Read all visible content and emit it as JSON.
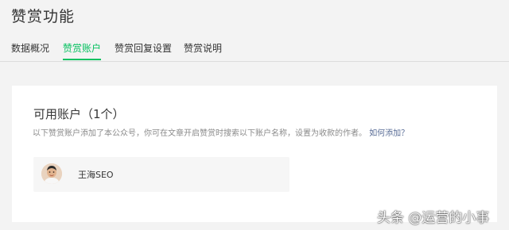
{
  "page": {
    "title": "赞赏功能"
  },
  "tabs": [
    {
      "label": "数据概况",
      "active": false
    },
    {
      "label": "赞赏账户",
      "active": true
    },
    {
      "label": "赞赏回复设置",
      "active": false
    },
    {
      "label": "赞赏说明",
      "active": false
    }
  ],
  "accounts_section": {
    "title": "可用账户（1个）",
    "description": "以下赞赏账户添加了本公众号，你可在文章开启赞赏时搜索以下账户名称，设置为收款的作者。",
    "help_link": "如何添加？",
    "accounts": [
      {
        "name": "王海SEO",
        "avatar_icon": "user-avatar"
      }
    ]
  },
  "watermark": {
    "text": "头条 @运营的小事"
  },
  "colors": {
    "accent": "#07c160",
    "link": "#576b95",
    "background": "#f3f3f3",
    "card": "#ffffff"
  }
}
